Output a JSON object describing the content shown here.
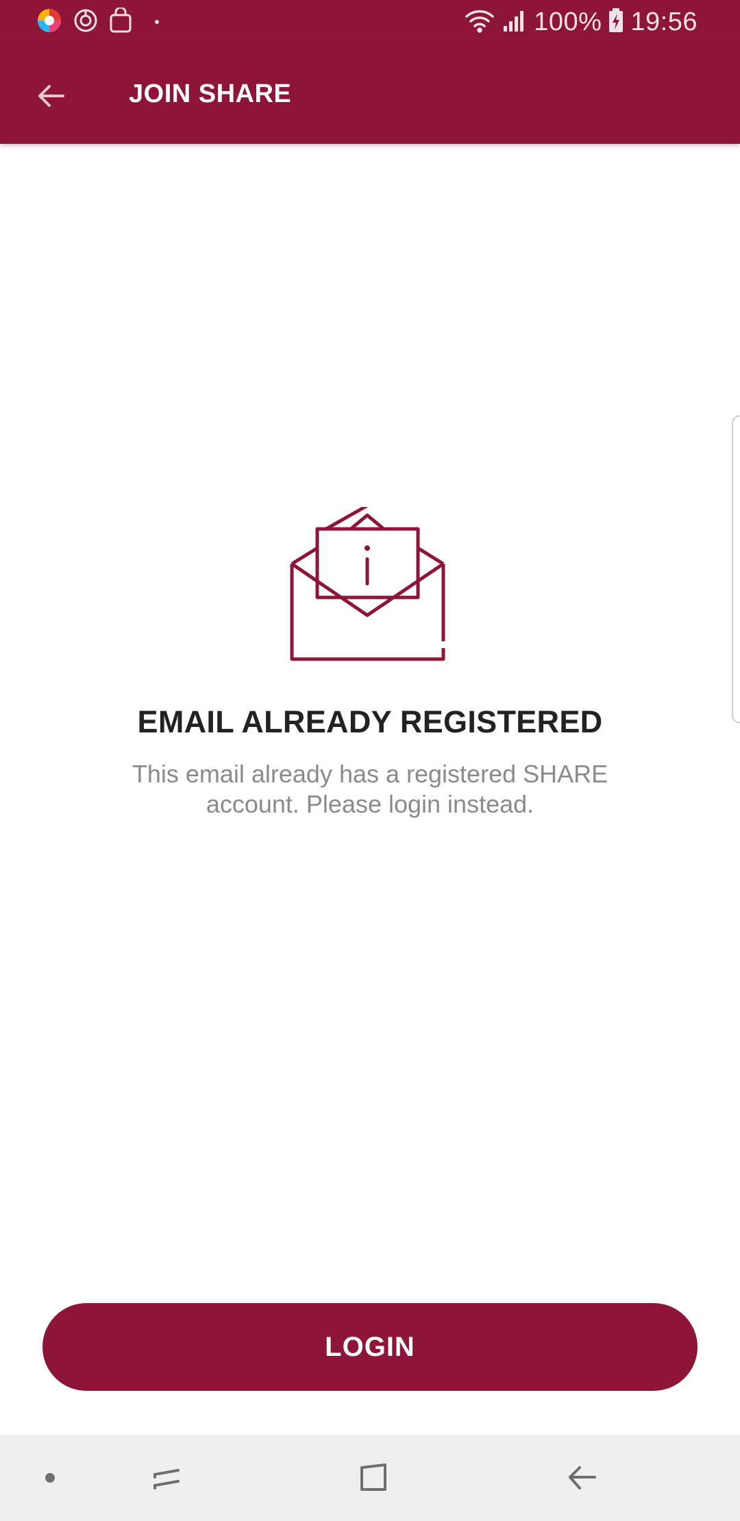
{
  "status_bar": {
    "battery": "100%",
    "time": "19:56",
    "icons": [
      "browser-app-icon",
      "sync-icon",
      "shopping-bag-icon",
      "notification-dot-icon",
      "wifi-icon",
      "signal-icon",
      "battery-charging-icon"
    ]
  },
  "app_bar": {
    "title": "JOIN SHARE",
    "back_icon": "arrow-left-icon"
  },
  "main": {
    "illustration_icon": "email-info-icon",
    "title": "EMAIL ALREADY REGISTERED",
    "body": "This email already has a registered SHARE account. Please login instead."
  },
  "actions": {
    "login_label": "LOGIN"
  },
  "nav_bar": {
    "items": [
      "nav-dot-icon",
      "recents-icon",
      "home-icon",
      "back-icon"
    ]
  },
  "colors": {
    "brand": "#8c1538",
    "title_text": "#222222",
    "body_text": "#8a8a8a",
    "nav_background": "#efefef"
  }
}
